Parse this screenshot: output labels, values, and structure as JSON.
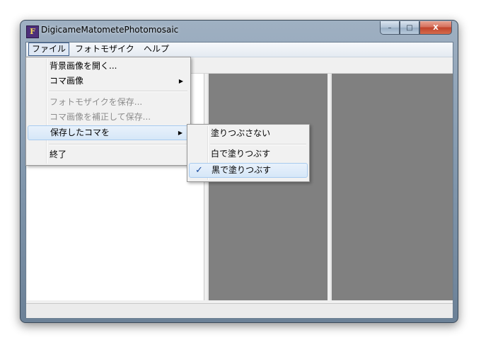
{
  "window": {
    "title": "DigicameMatometePhotomosaic",
    "app_icon_glyph": "F"
  },
  "caption": {
    "minimize": "–",
    "maximize": "□",
    "close": "X"
  },
  "menubar": {
    "items": [
      {
        "label": "ファイル"
      },
      {
        "label": "フォトモザイク"
      },
      {
        "label": "ヘルプ"
      }
    ]
  },
  "file_menu": {
    "items": [
      {
        "label": "背景画像を開く...",
        "enabled": true
      },
      {
        "label": "コマ画像",
        "enabled": true,
        "submenu": true
      },
      {
        "label": "フォトモザイクを保存...",
        "enabled": false
      },
      {
        "label": "コマ画像を補正して保存...",
        "enabled": false
      },
      {
        "label": "保存したコマを",
        "enabled": true,
        "submenu": true,
        "highlighted": true
      },
      {
        "label": "終了",
        "enabled": true
      }
    ]
  },
  "saved_frames_submenu": {
    "items": [
      {
        "label": "塗りつぶさない",
        "checked": false
      },
      {
        "label": "白で塗りつぶす",
        "checked": false
      },
      {
        "label": "黒で塗りつぶす",
        "checked": true,
        "highlighted": true
      }
    ],
    "check_glyph": "✓"
  },
  "submenu_arrow": "▶",
  "colors": {
    "preview_panel": "#808080",
    "menu_highlight": "#d6e7f8",
    "check_mark": "#1a4b9d"
  }
}
